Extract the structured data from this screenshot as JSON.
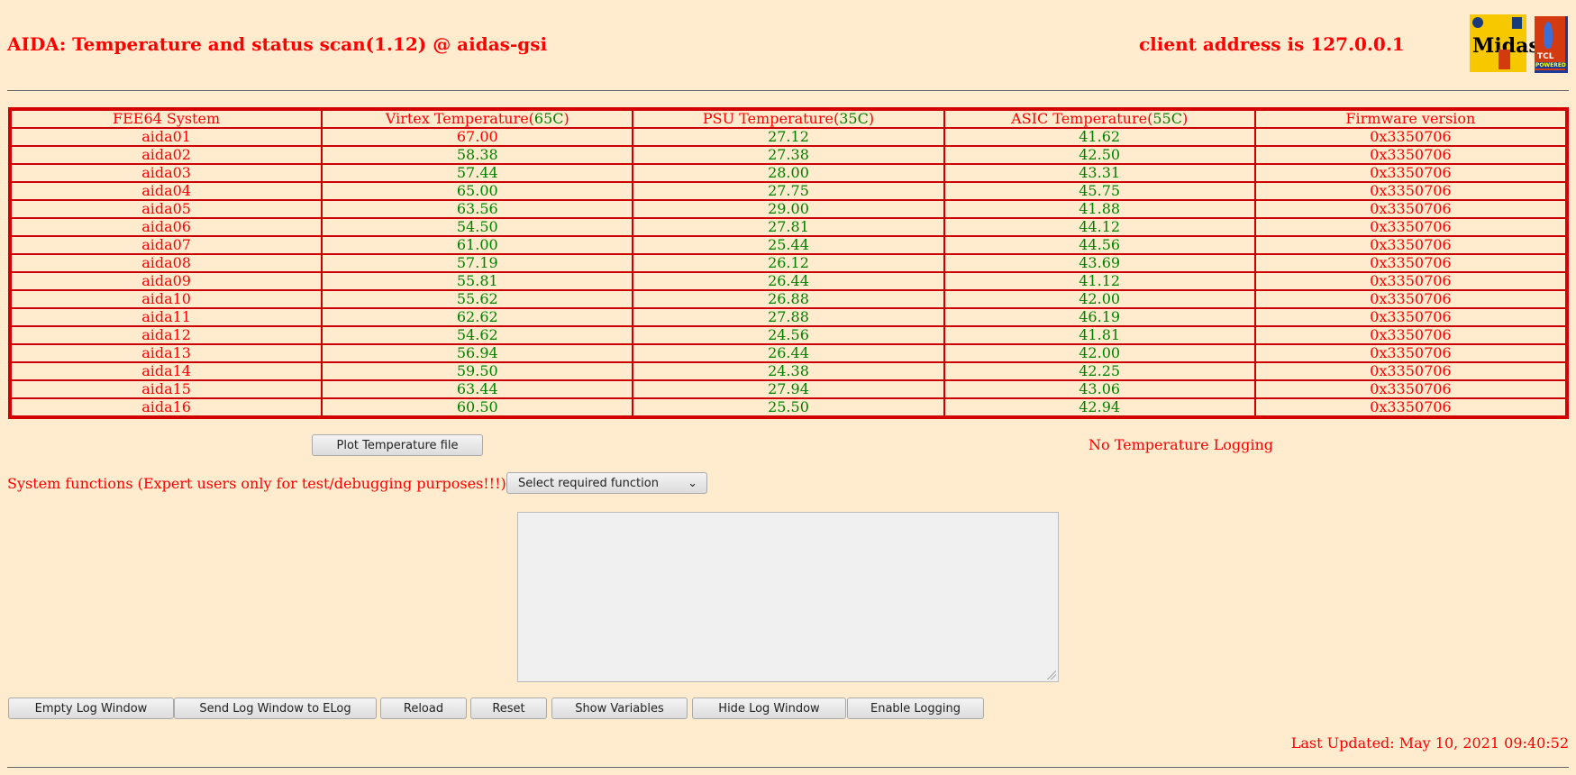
{
  "header": {
    "title": "AIDA: Temperature and status scan(1.12) @ aidas-gsi",
    "client": "client address is 127.0.0.1",
    "logo_midas": "Midas",
    "logo_tcl": "TCL POWERED"
  },
  "table": {
    "headers": [
      {
        "text": "FEE64 System",
        "limit": ""
      },
      {
        "text": "Virtex Temperature(",
        "limit": "65C",
        "close": ")"
      },
      {
        "text": "PSU Temperature(",
        "limit": "35C",
        "close": ")"
      },
      {
        "text": "ASIC Temperature(",
        "limit": "55C",
        "close": ")"
      },
      {
        "text": "Firmware version",
        "limit": ""
      }
    ],
    "rows": [
      {
        "system": "aida01",
        "virtex": "67.00",
        "virtex_alarm": true,
        "psu": "27.12",
        "asic": "41.62",
        "fw": "0x3350706"
      },
      {
        "system": "aida02",
        "virtex": "58.38",
        "psu": "27.38",
        "asic": "42.50",
        "fw": "0x3350706"
      },
      {
        "system": "aida03",
        "virtex": "57.44",
        "psu": "28.00",
        "asic": "43.31",
        "fw": "0x3350706"
      },
      {
        "system": "aida04",
        "virtex": "65.00",
        "psu": "27.75",
        "asic": "45.75",
        "fw": "0x3350706"
      },
      {
        "system": "aida05",
        "virtex": "63.56",
        "psu": "29.00",
        "asic": "41.88",
        "fw": "0x3350706"
      },
      {
        "system": "aida06",
        "virtex": "54.50",
        "psu": "27.81",
        "asic": "44.12",
        "fw": "0x3350706"
      },
      {
        "system": "aida07",
        "virtex": "61.00",
        "psu": "25.44",
        "asic": "44.56",
        "fw": "0x3350706"
      },
      {
        "system": "aida08",
        "virtex": "57.19",
        "psu": "26.12",
        "asic": "43.69",
        "fw": "0x3350706"
      },
      {
        "system": "aida09",
        "virtex": "55.81",
        "psu": "26.44",
        "asic": "41.12",
        "fw": "0x3350706"
      },
      {
        "system": "aida10",
        "virtex": "55.62",
        "psu": "26.88",
        "asic": "42.00",
        "fw": "0x3350706"
      },
      {
        "system": "aida11",
        "virtex": "62.62",
        "psu": "27.88",
        "asic": "46.19",
        "fw": "0x3350706"
      },
      {
        "system": "aida12",
        "virtex": "54.62",
        "psu": "24.56",
        "asic": "41.81",
        "fw": "0x3350706"
      },
      {
        "system": "aida13",
        "virtex": "56.94",
        "psu": "26.44",
        "asic": "42.00",
        "fw": "0x3350706"
      },
      {
        "system": "aida14",
        "virtex": "59.50",
        "psu": "24.38",
        "asic": "42.25",
        "fw": "0x3350706"
      },
      {
        "system": "aida15",
        "virtex": "63.44",
        "psu": "27.94",
        "asic": "43.06",
        "fw": "0x3350706"
      },
      {
        "system": "aida16",
        "virtex": "60.50",
        "psu": "25.50",
        "asic": "42.94",
        "fw": "0x3350706"
      }
    ]
  },
  "plot_button": "Plot Temperature file",
  "logging_status": "No Temperature Logging",
  "system_functions_label": "System functions (Expert users only for test/debugging purposes!!!)",
  "function_select": {
    "value": "Select required function"
  },
  "log_window": {
    "value": ""
  },
  "buttons": [
    "Empty Log Window",
    "Send Log Window to ELog",
    "Reload",
    "Reset",
    "Show Variables",
    "Hide Log Window",
    "Enable Logging"
  ],
  "last_updated": "Last Updated: May 10, 2021 09:40:52",
  "colors": {
    "alarm": "#ff0000",
    "ok": "#008000",
    "background": "#ffebcd"
  }
}
